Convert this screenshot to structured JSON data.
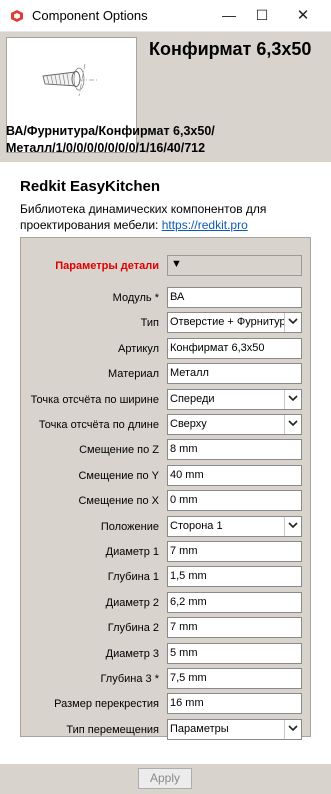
{
  "window": {
    "title": "Component Options",
    "minimize": "—",
    "maximize": "☐",
    "close": "✕"
  },
  "component": {
    "name": "Конфирмат 6,3х50",
    "path": "ВА/Фурнитура/Конфирмат 6,3х50/Металл/1/0/0/0/0/0/0/0/1/16/40/712"
  },
  "library": {
    "title": "Redkit EasyKitchen",
    "description": "Библиотека динамических компонентов для проектирования мебели: ",
    "link": "https://redkit.pro"
  },
  "section": {
    "title": "Параметры детали",
    "toggle": "▼"
  },
  "fields": [
    {
      "label": "Модуль *",
      "value": "ВА",
      "type": "text"
    },
    {
      "label": "Тип",
      "value": "Отверстие + Фурнитура",
      "type": "select"
    },
    {
      "label": "Артикул",
      "value": "Конфирмат 6,3х50",
      "type": "text"
    },
    {
      "label": "Материал",
      "value": "Металл",
      "type": "text"
    },
    {
      "label": "Точка отсчёта по ширине",
      "value": "Спереди",
      "type": "select"
    },
    {
      "label": "Точка отсчёта по длине",
      "value": "Сверху",
      "type": "select"
    },
    {
      "label": "Смещение по Z",
      "value": "8 mm",
      "type": "text"
    },
    {
      "label": "Смещение по Y",
      "value": "40 mm",
      "type": "text"
    },
    {
      "label": "Смещение по X",
      "value": "0 mm",
      "type": "text"
    },
    {
      "label": "Положение",
      "value": "Сторона 1",
      "type": "select"
    },
    {
      "label": "Диаметр 1",
      "value": "7 mm",
      "type": "text"
    },
    {
      "label": "Глубина 1",
      "value": "1,5 mm",
      "type": "text"
    },
    {
      "label": "Диаметр 2",
      "value": "6,2 mm",
      "type": "text"
    },
    {
      "label": "Глубина 2",
      "value": "7 mm",
      "type": "text"
    },
    {
      "label": "Диаметр 3",
      "value": "5 mm",
      "type": "text"
    },
    {
      "label": "Глубина 3 *",
      "value": "7,5 mm",
      "type": "text"
    },
    {
      "label": "Размер перекрестия",
      "value": "16 mm",
      "type": "text"
    },
    {
      "label": "Тип перемещения",
      "value": "Параметры",
      "type": "select"
    }
  ],
  "footer": {
    "apply": "Apply"
  },
  "colors": {
    "panel": "#d8d4cd",
    "section_title": "#e00000",
    "link": "#0b5bb5"
  }
}
